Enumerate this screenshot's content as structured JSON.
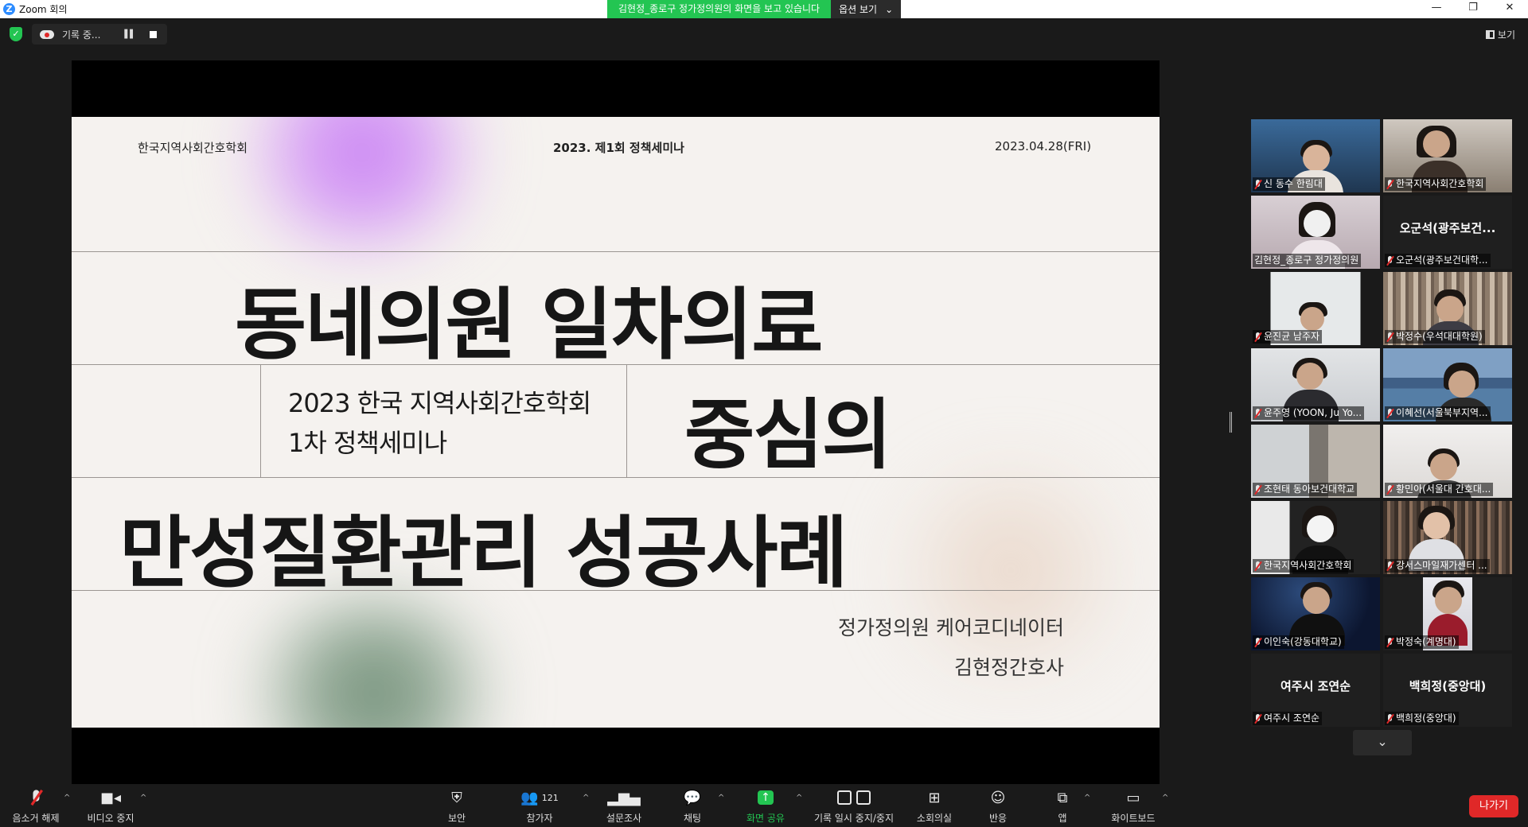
{
  "window": {
    "title": "Zoom 회의",
    "share_banner": "김현정_종로구 정가정의원의 화면을 보고 있습니다",
    "view_options": "옵션 보기"
  },
  "status": {
    "recording_label": "기록 중...",
    "view_button": "보기"
  },
  "slide": {
    "org": "한국지역사회간호학회",
    "event": "2023. 제1회 정책세미나",
    "date": "2023.04.28(FRI)",
    "title_line1": "동네의원 일차의료",
    "title_line2": "중심의",
    "title_line3": "만성질환관리 성공사례",
    "subtitle_line1": "2023 한국 지역사회간호학회",
    "subtitle_line2": "1차 정책세미나",
    "presenter_line1": "정가정의원 케어코디네이터",
    "presenter_line2": "김현정간호사"
  },
  "participants": [
    {
      "name": "신 동수 한림대",
      "big": ""
    },
    {
      "name": "한국지역사회간호학회",
      "big": ""
    },
    {
      "name": "김현정_종로구 정가정의원",
      "big": ""
    },
    {
      "name": "오군석(광주보건대학...",
      "big": "오군석(광주보건..."
    },
    {
      "name": "윤진균 남주자",
      "big": ""
    },
    {
      "name": "박정수(우석대대학원)",
      "big": ""
    },
    {
      "name": "윤주영 (YOON, Ju Yo...",
      "big": ""
    },
    {
      "name": "이혜선(서울북부지역...",
      "big": ""
    },
    {
      "name": "조현태 동아보건대학교",
      "big": ""
    },
    {
      "name": "황민아(서울대 간호대...",
      "big": ""
    },
    {
      "name": "한국지역사회간호학회",
      "big": ""
    },
    {
      "name": "강서스마일재가센터 ...",
      "big": ""
    },
    {
      "name": "이인숙(강동대학교)",
      "big": ""
    },
    {
      "name": "박정숙(계명대)",
      "big": ""
    },
    {
      "name": "여주시 조연순",
      "big": "여주시 조연순"
    },
    {
      "name": "백희정(중앙대)",
      "big": "백희정(중앙대)"
    }
  ],
  "toolbar": {
    "unmute": "음소거 해제",
    "stop_video": "비디오 중지",
    "security": "보안",
    "participants": "참가자",
    "participants_count": "121",
    "polls": "설문조사",
    "chat": "채팅",
    "share_screen": "화면 공유",
    "pause_stop_recording": "기록 일시 중지/중지",
    "breakout_rooms": "소회의실",
    "reactions": "반응",
    "apps": "앱",
    "whiteboard": "화이트보드",
    "leave": "나가기"
  },
  "colors": {
    "accent_green": "#23c552",
    "leave_red": "#e02828",
    "active_speaker": "#c6dd3a"
  }
}
